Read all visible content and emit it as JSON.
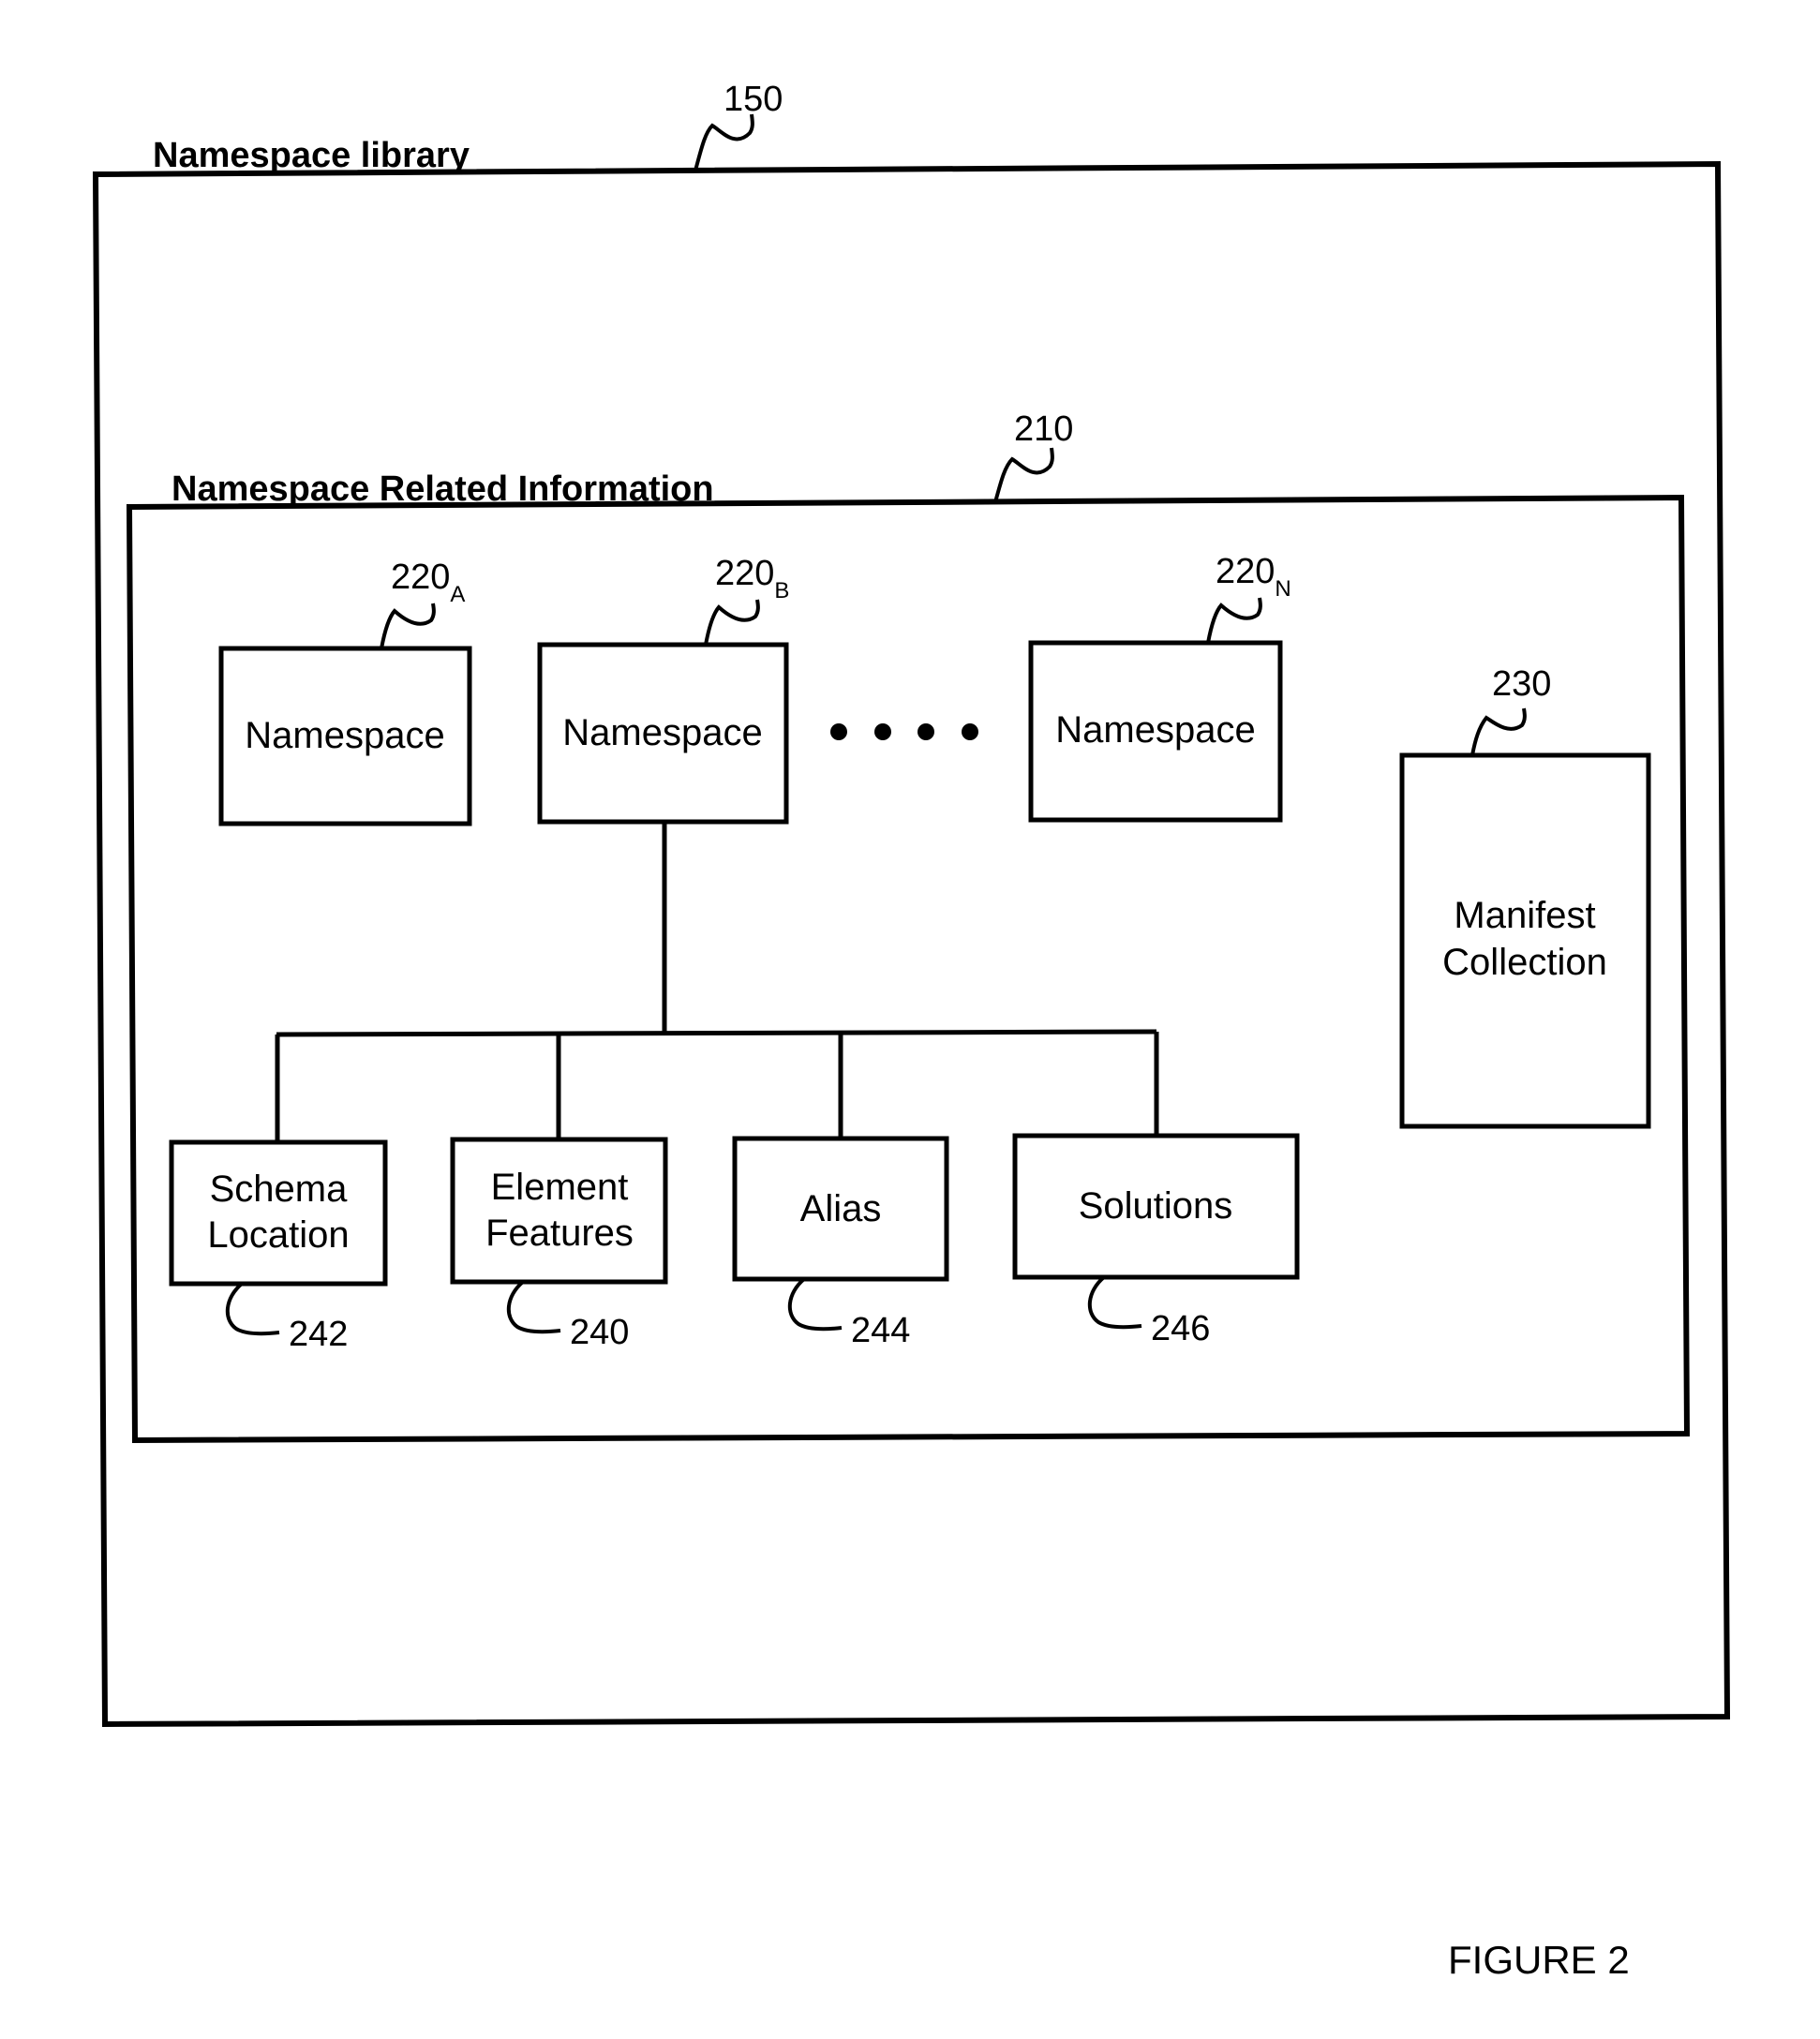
{
  "figure_label": "FIGURE 2",
  "library": {
    "title": "Namespace library",
    "ref": "150"
  },
  "related_info": {
    "title": "Namespace Related Information",
    "ref": "210"
  },
  "namespaces": [
    {
      "label": "Namespace",
      "ref": "220",
      "sub": "A"
    },
    {
      "label": "Namespace",
      "ref": "220",
      "sub": "B"
    },
    {
      "label": "Namespace",
      "ref": "220",
      "sub": "N"
    }
  ],
  "ellipsis_dots": 4,
  "manifest": {
    "line1": "Manifest",
    "line2": "Collection",
    "ref": "230"
  },
  "components": [
    {
      "line1": "Schema",
      "line2": "Location",
      "ref": "242"
    },
    {
      "line1": "Element",
      "line2": "Features",
      "ref": "240"
    },
    {
      "line1": "Alias",
      "line2": "",
      "ref": "244"
    },
    {
      "line1": "Solutions",
      "line2": "",
      "ref": "246"
    }
  ]
}
